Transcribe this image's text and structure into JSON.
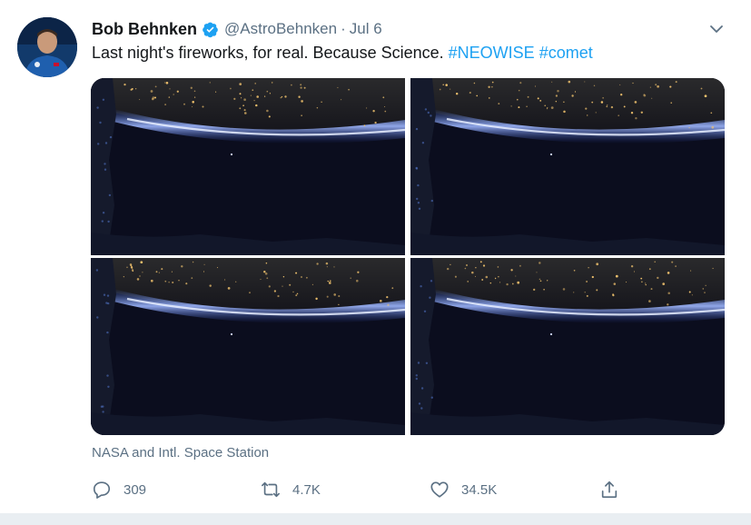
{
  "tweet": {
    "author": {
      "display_name": "Bob Behnken",
      "handle": "@AstroBehnken",
      "separator": "·",
      "date": "Jul 6",
      "verified": true
    },
    "text": "Last night's fireworks, for real. Because Science.",
    "hashtags": [
      "#NEOWISE",
      "#comet"
    ],
    "photos": [
      {
        "alt": "Earth at night with city lights and a comet from the ISS"
      },
      {
        "alt": "Earth at night with city lights and a comet from the ISS"
      },
      {
        "alt": "Earth at night with city lights and a comet from the ISS"
      },
      {
        "alt": "Earth at night with city lights and a comet from the ISS"
      }
    ],
    "location": "NASA and Intl. Space Station",
    "actions": {
      "reply_count": "309",
      "retweet_count": "4.7K",
      "like_count": "34.5K"
    }
  },
  "colors": {
    "link": "#1da1f2",
    "secondary_text": "#5b7083",
    "primary_text": "#14171a",
    "verified_badge": "#1da1f2"
  },
  "icons": {
    "verified": "verified-badge-icon",
    "caret": "chevron-down-icon",
    "reply": "reply-icon",
    "retweet": "retweet-icon",
    "like": "heart-icon",
    "share": "share-icon"
  }
}
